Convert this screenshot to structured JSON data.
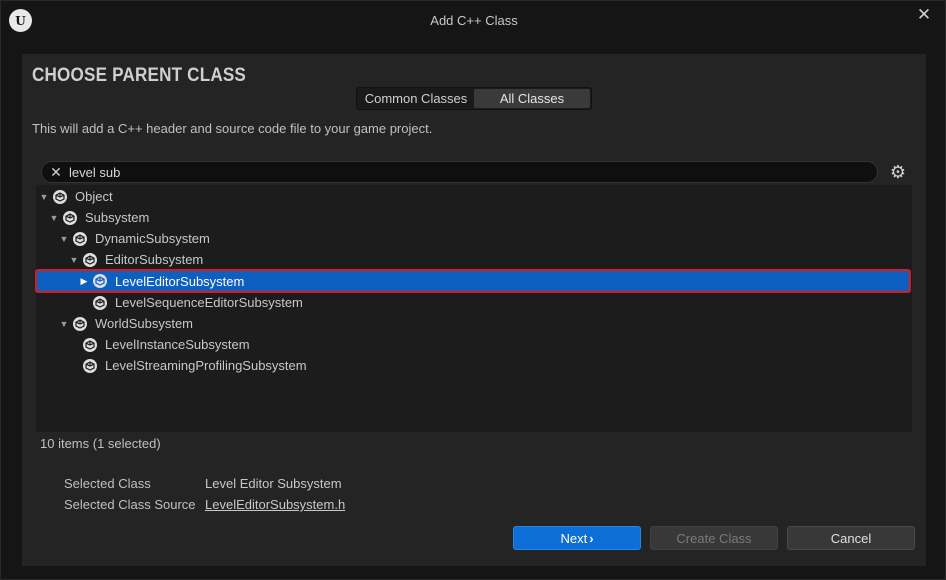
{
  "window": {
    "title": "Add C++ Class",
    "logo_text": "U"
  },
  "heading": "CHOOSE PARENT CLASS",
  "tabs": [
    {
      "label": "Common Classes",
      "active": false
    },
    {
      "label": "All Classes",
      "active": true
    }
  ],
  "description": "This will add a C++ header and source code file to your game project.",
  "search": {
    "value": "level sub"
  },
  "tree": {
    "items": [
      {
        "label": "Object",
        "depth": 0,
        "expanded": true
      },
      {
        "label": "Subsystem",
        "depth": 1,
        "expanded": true
      },
      {
        "label": "DynamicSubsystem",
        "depth": 2,
        "expanded": true
      },
      {
        "label": "EditorSubsystem",
        "depth": 3,
        "expanded": true
      },
      {
        "label": "LevelEditorSubsystem",
        "depth": 4,
        "expanded": false,
        "has_children": true,
        "selected": true
      },
      {
        "label": "LevelSequenceEditorSubsystem",
        "depth": 4,
        "expanded": false
      },
      {
        "label": "WorldSubsystem",
        "depth": 2,
        "expanded": true
      },
      {
        "label": "LevelInstanceSubsystem",
        "depth": 3,
        "expanded": false
      },
      {
        "label": "LevelStreamingProfilingSubsystem",
        "depth": 3,
        "expanded": false
      }
    ]
  },
  "status": "10 items (1 selected)",
  "selected_class": {
    "label": "Selected Class",
    "value": "Level Editor Subsystem"
  },
  "selected_class_source": {
    "label": "Selected Class Source",
    "value": "LevelEditorSubsystem.h"
  },
  "buttons": {
    "next": "Next",
    "create": "Create Class",
    "cancel": "Cancel"
  },
  "colors": {
    "accent": "#0e6ed8",
    "selection": "#0d5fc0",
    "highlight_border": "#d81b1b"
  },
  "icons": {
    "close": "close-icon",
    "clear": "clear-search-icon",
    "settings": "gear-icon",
    "class": "class-icon"
  }
}
